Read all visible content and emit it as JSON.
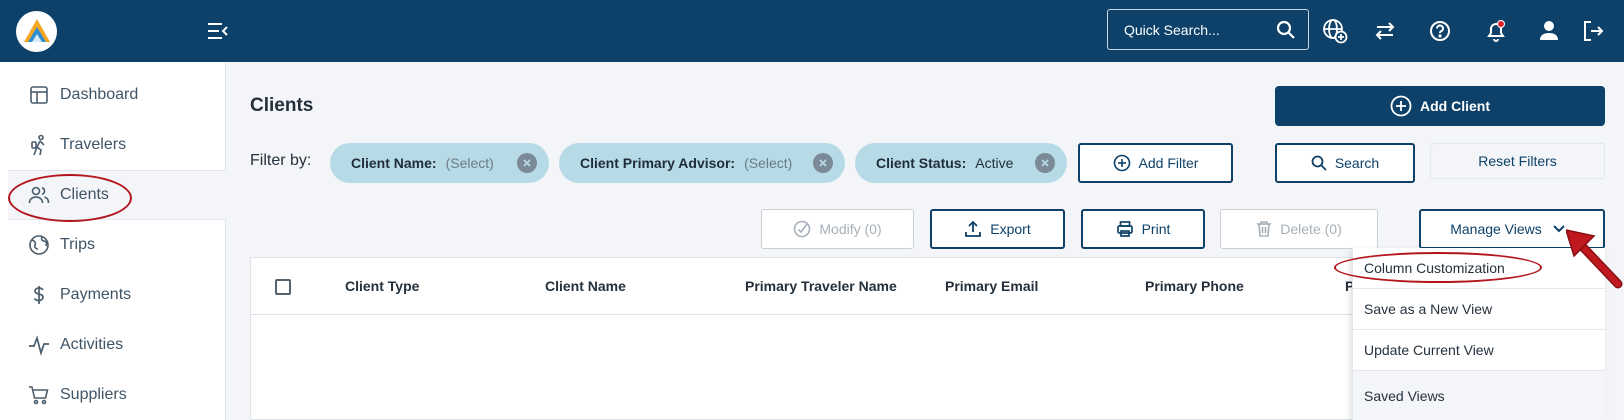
{
  "header": {
    "logo_icon": "triangle-logo-icon",
    "search_placeholder": "Quick Search...",
    "icons": [
      "menu-collapse-icon",
      "search-icon",
      "globe-plus-icon",
      "swap-icon",
      "help-icon",
      "bell-icon",
      "user-icon",
      "logout-icon"
    ],
    "brand_color": "#0d4169",
    "notification_dot_color": "#e0242b"
  },
  "sidebar": {
    "items": [
      {
        "label": "Dashboard",
        "icon": "dashboard-icon"
      },
      {
        "label": "Travelers",
        "icon": "traveler-icon"
      },
      {
        "label": "Clients",
        "icon": "clients-icon",
        "active": true
      },
      {
        "label": "Trips",
        "icon": "globe-icon"
      },
      {
        "label": "Payments",
        "icon": "dollar-icon"
      },
      {
        "label": "Activities",
        "icon": "pulse-icon"
      },
      {
        "label": "Suppliers",
        "icon": "cart-icon"
      }
    ]
  },
  "main": {
    "title": "Clients",
    "add_client_label": "Add Client",
    "filter_label": "Filter by:",
    "chips": [
      {
        "label": "Client Name:",
        "value": "(Select)"
      },
      {
        "label": "Client Primary Advisor:",
        "value": "(Select)"
      },
      {
        "label": "Client Status:",
        "value": "Active"
      }
    ],
    "add_filter_label": "Add Filter",
    "search_label": "Search",
    "reset_label": "Reset Filters",
    "actions": {
      "modify": "Modify (0)",
      "export": "Export",
      "print": "Print",
      "delete": "Delete (0)",
      "manage_views": "Manage Views"
    },
    "columns": [
      "Client Type",
      "Client Name",
      "Primary Traveler Name",
      "Primary Email",
      "Primary Phone",
      "P"
    ]
  },
  "manage_views_menu": {
    "items": [
      "Column Customization",
      "Save as a New View",
      "Update Current View",
      "Saved Views"
    ]
  },
  "annotation_color": "#b3171d"
}
